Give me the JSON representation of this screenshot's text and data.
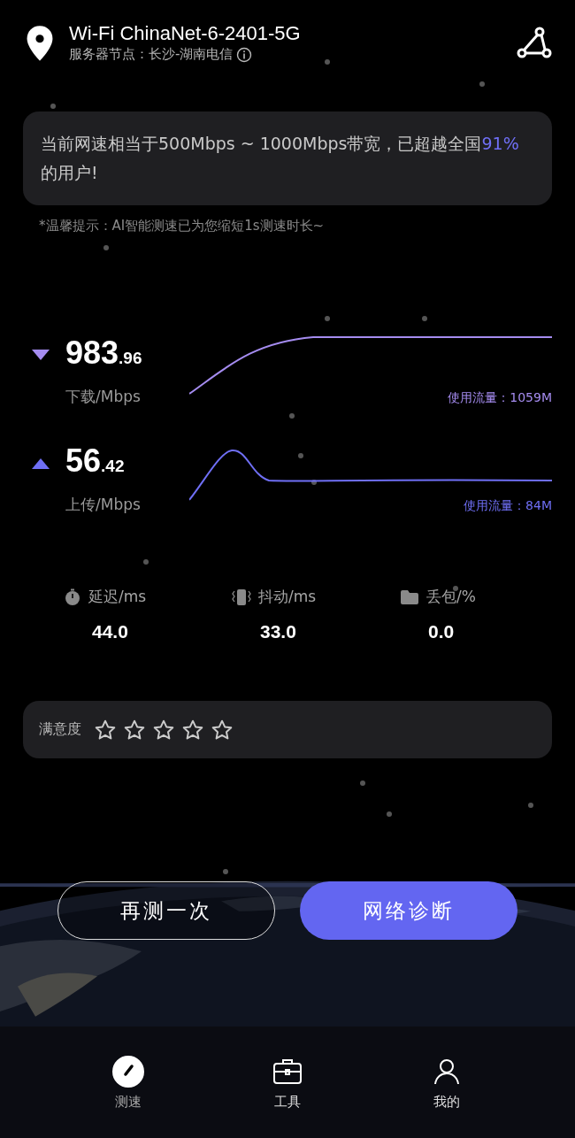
{
  "header": {
    "title": "Wi-Fi ChinaNet-6-2401-5G",
    "server": "服务器节点：长沙-湖南电信"
  },
  "summary": {
    "text": "当前网速相当于500Mbps ~ 1000Mbps带宽，已超越全国**91%**的用户!"
  },
  "hint": "*温馨提示：AI智能测速已为您缩短1s测速时长~",
  "speeds": [
    {
      "kind": "download",
      "value": "983",
      "decimals": ".96",
      "unit": "下载/Mbps",
      "usage": "使用流量：1059M"
    },
    {
      "kind": "upload",
      "value": "56",
      "decimals": ".42",
      "unit": "上传/Mbps",
      "usage": "使用流量：84M"
    }
  ],
  "metrics": [
    {
      "kind": "latency",
      "label": "延迟/ms",
      "value": "44.0"
    },
    {
      "kind": "jitter",
      "label": "抖动/ms",
      "value": "33.0"
    },
    {
      "kind": "loss",
      "label": "丢包/%",
      "value": "0.0"
    }
  ],
  "rating": {
    "label": "满意度",
    "stars": 0
  },
  "buttons": [
    {
      "kind": "outline",
      "label": "再测一次"
    },
    {
      "kind": "primary",
      "label": "网络诊断"
    }
  ],
  "tabs": [
    {
      "kind": "speed",
      "label": "测速",
      "selected": true
    },
    {
      "kind": "tools",
      "label": "工具",
      "selected": false
    },
    {
      "kind": "me",
      "label": "我的",
      "selected": false
    }
  ]
}
